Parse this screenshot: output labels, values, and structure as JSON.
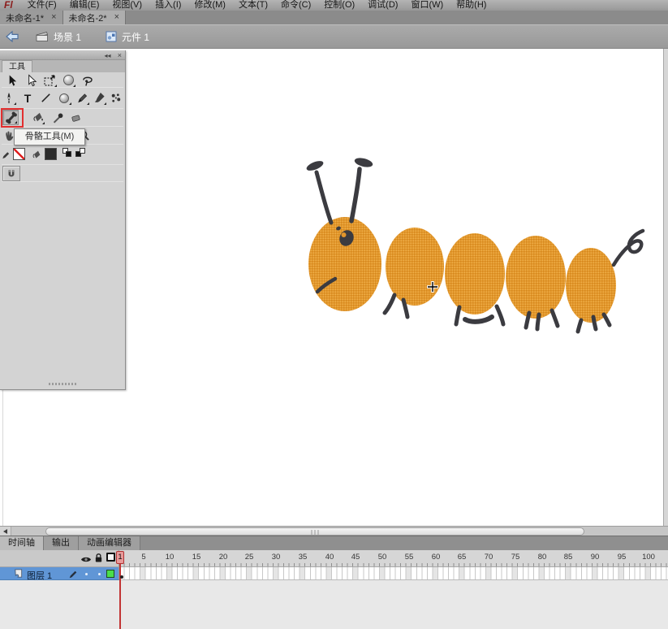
{
  "menu": {
    "logo": "Fl",
    "items": [
      "文件(F)",
      "编辑(E)",
      "视图(V)",
      "插入(I)",
      "修改(M)",
      "文本(T)",
      "命令(C)",
      "控制(O)",
      "调试(D)",
      "窗口(W)",
      "帮助(H)"
    ]
  },
  "doc_tabs": [
    {
      "label": "未命名-1*",
      "close": "×",
      "active": false
    },
    {
      "label": "未命名-2*",
      "close": "×",
      "active": true
    }
  ],
  "edit_bar": {
    "scene": "场景 1",
    "symbol": "元件 1"
  },
  "tools": {
    "panel_title": "工具",
    "collapse_icon": "◂◂",
    "close_icon": "×",
    "tooltip": "骨骼工具(M)",
    "text_glyph": "T"
  },
  "timeline": {
    "tabs": [
      "时间轴",
      "输出",
      "动画编辑器"
    ],
    "layer_name": "图层 1",
    "current_frame": "1",
    "ruler_labels": [
      "5",
      "10",
      "15",
      "20",
      "25",
      "30",
      "35",
      "40",
      "45",
      "50",
      "55",
      "60",
      "65",
      "70",
      "75",
      "80",
      "85",
      "90",
      "95",
      "100"
    ]
  },
  "colors": {
    "caterpillar_orange": "#e2962c",
    "caterpillar_dark": "#3b3b40",
    "layer_selection_blue": "#6096d6",
    "playhead_red": "#c23434",
    "tool_highlight_red": "#e23030",
    "keyframe_outline_green": "#4ade4a"
  }
}
